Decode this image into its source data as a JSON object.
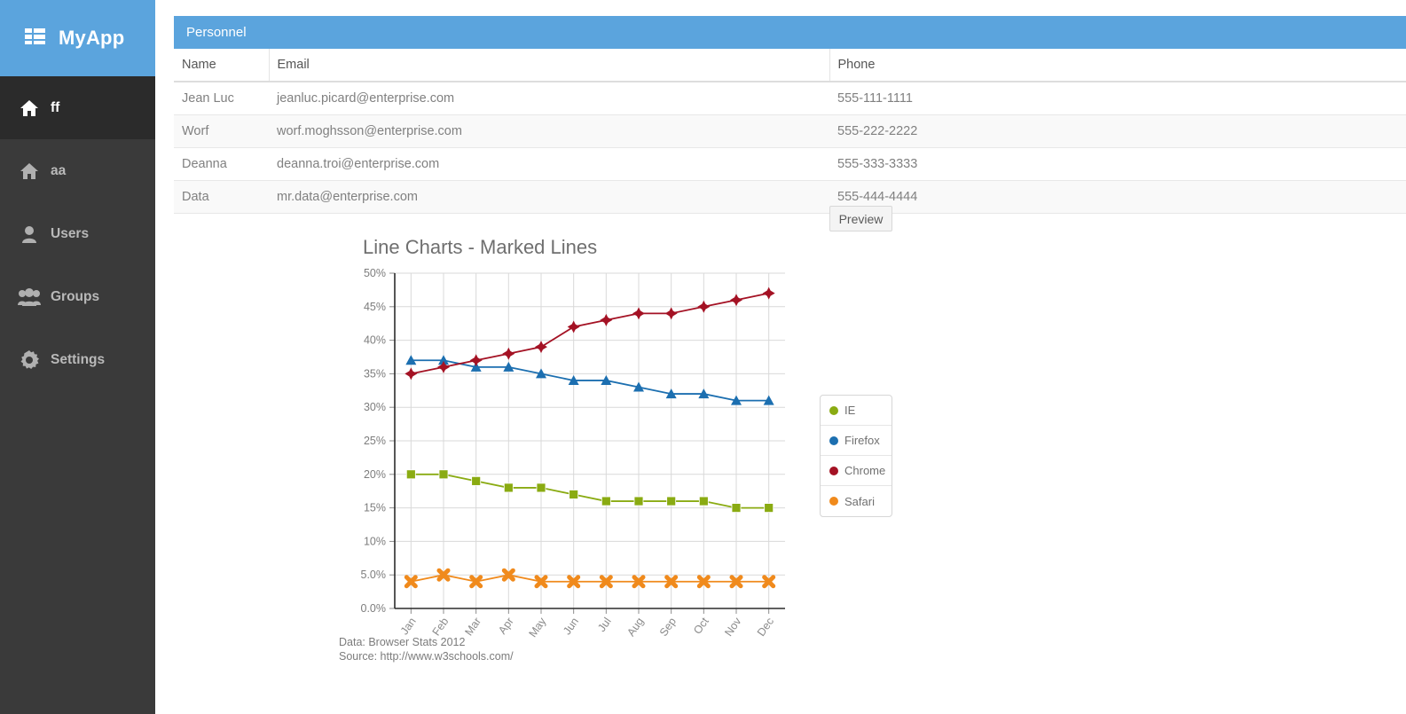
{
  "sidebar": {
    "brand": {
      "label": "MyApp",
      "icon": "grid-list-icon",
      "bg": "#5ba4dd"
    },
    "items": [
      {
        "label": "ff",
        "icon": "home-icon",
        "active": true
      },
      {
        "label": "aa",
        "icon": "home-icon",
        "active": false
      },
      {
        "label": "Users",
        "icon": "user-icon",
        "active": false
      },
      {
        "label": "Groups",
        "icon": "users-group-icon",
        "active": false
      },
      {
        "label": "Settings",
        "icon": "gear-icon",
        "active": false
      }
    ]
  },
  "panel": {
    "title": "Personnel",
    "columns": [
      "Name",
      "Email",
      "Phone"
    ],
    "rows": [
      {
        "name": "Jean Luc",
        "email": "jeanluc.picard@enterprise.com",
        "phone": "555-111-1111"
      },
      {
        "name": "Worf",
        "email": "worf.moghsson@enterprise.com",
        "phone": "555-222-2222"
      },
      {
        "name": "Deanna",
        "email": "deanna.troi@enterprise.com",
        "phone": "555-333-3333"
      },
      {
        "name": "Data",
        "email": "mr.data@enterprise.com",
        "phone": "555-444-4444"
      }
    ]
  },
  "toolbar": {
    "preview_label": "Preview"
  },
  "chart_data": {
    "type": "line",
    "title": "Line Charts - Marked Lines",
    "xlabel": "",
    "ylabel": "",
    "ylim": [
      0,
      50
    ],
    "ytick_labels": [
      "0.0%",
      "5.0%",
      "10%",
      "15%",
      "20%",
      "25%",
      "30%",
      "35%",
      "40%",
      "45%",
      "50%"
    ],
    "ytick_values": [
      0,
      5,
      10,
      15,
      20,
      25,
      30,
      35,
      40,
      45,
      50
    ],
    "grid": true,
    "legend_position": "right",
    "categories": [
      "Jan",
      "Feb",
      "Mar",
      "Apr",
      "May",
      "Jun",
      "Jul",
      "Aug",
      "Sep",
      "Oct",
      "Nov",
      "Dec"
    ],
    "series": [
      {
        "name": "IE",
        "color": "#8aab12",
        "marker": "square",
        "values": [
          20,
          20,
          19,
          18,
          18,
          17,
          16,
          16,
          16,
          16,
          15,
          15
        ]
      },
      {
        "name": "Firefox",
        "color": "#1c6fb0",
        "marker": "triangle",
        "values": [
          37,
          37,
          36,
          36,
          35,
          34,
          34,
          33,
          32,
          32,
          31,
          31
        ]
      },
      {
        "name": "Chrome",
        "color": "#a41224",
        "marker": "diamond",
        "values": [
          35,
          36,
          37,
          38,
          39,
          42,
          43,
          44,
          44,
          45,
          46,
          47
        ]
      },
      {
        "name": "Safari",
        "color": "#f08a1c",
        "marker": "cross",
        "values": [
          4,
          5,
          4,
          5,
          4,
          4,
          4,
          4,
          4,
          4,
          4,
          4
        ]
      }
    ],
    "annotations": [
      "Data: Browser Stats 2012",
      "Source: http://www.w3schools.com/"
    ]
  },
  "chart_footer": {
    "line1": "Data: Browser Stats 2012",
    "line2": "Source: http://www.w3schools.com/"
  }
}
